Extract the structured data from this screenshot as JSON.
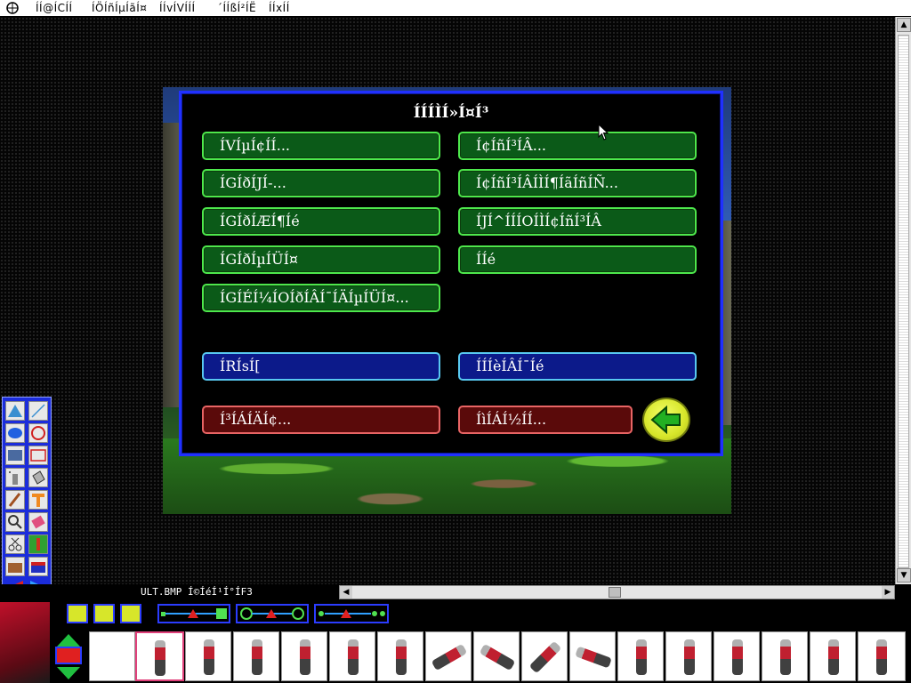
{
  "menubar": {
    "items": [
      "ÍÍ@ÍCÍÍ",
      "ÍÖÍñÍµÍãÍ¤",
      "ÍÍvÍVÍÍÍ",
      "´ÍÍßÍ²ÍË",
      "ÍÍxÍÍ"
    ]
  },
  "dialog": {
    "title": "ÍÍÍÌÍ»Í¤Í³",
    "buttons_left": [
      "ÍVÍµÍ¢ÍÍ...",
      "ÍGÍðÍJÍ-...",
      "ÍGÍðÍÆÍ¶Íé",
      "ÍGÍðÍµÍÜÍ¤",
      "ÍGÍÉÍ¼ÍOÍðÍÂÍ¯ÍÄÍµÍÜÍ¤..."
    ],
    "buttons_right": [
      "Í¢ÍñÍ³ÍÂ...",
      "Í¢ÍñÍ³ÍÂÍÌÍ¶ÍãÍñÍÑ...",
      "ÍJÍ^ÍÍÍOÍÌÍ¢ÍñÍ³ÍÂ",
      "ÍÍé"
    ],
    "blue_left": "ÍRÍsÍ[",
    "blue_right": "ÍÍÍèÍÂÍ¯Íé",
    "red_left": "Í³ÍÁÍÄÍ¢...",
    "red_right": "ÍìÍÁÍ½ÍÍ..."
  },
  "status": {
    "filename": "ULT.BMP  Í©ÍéÍ¹Í°ÍF3"
  },
  "icons": {
    "app_logo": "app-logo-icon",
    "back": "back-arrow-icon"
  },
  "colors": {
    "dialog_border": "#2030ff",
    "green_button": "#0b5a18",
    "blue_button": "#0c1a8a",
    "red_button": "#5a0a0a",
    "back_button": "#d7e62a"
  }
}
